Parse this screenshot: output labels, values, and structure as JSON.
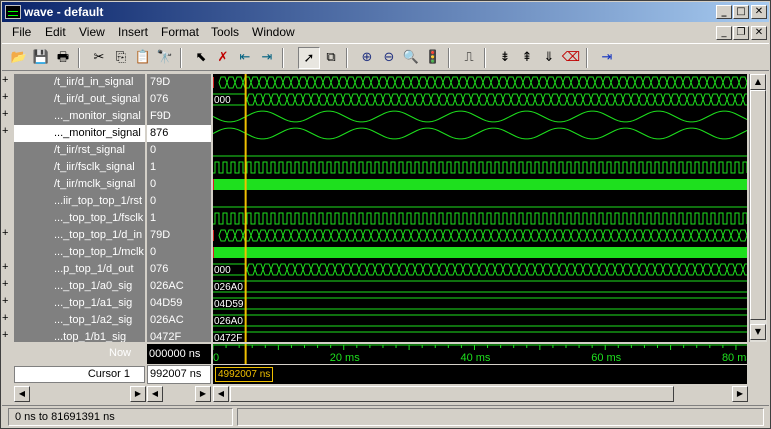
{
  "window": {
    "title": "wave - default"
  },
  "menu": [
    "File",
    "Edit",
    "View",
    "Insert",
    "Format",
    "Tools",
    "Window"
  ],
  "mdi_buttons": {
    "minimize": "_",
    "restore": "❐",
    "close": "✕"
  },
  "toolbar_icons": [
    "open-folder-icon",
    "save-icon",
    "print-icon",
    "cut-icon",
    "copy-icon",
    "paste-icon",
    "find-icon",
    "select-icon",
    "delete-icon",
    "insert-left-icon",
    "insert-right-icon",
    "pointer-icon",
    "zoom-area-icon",
    "zoom-in-icon",
    "zoom-out-icon",
    "zoom-full-icon",
    "traffic-light-icon",
    "find-edge-icon",
    "next-edge-icon",
    "prev-edge-icon",
    "find-value-icon",
    "delete-marker-icon",
    "goto-cursor-icon"
  ],
  "signals": [
    {
      "name": "/t_iir/d_in_signal",
      "value": "79D",
      "expand": true,
      "kind": "bus-dense"
    },
    {
      "name": "/t_iir/d_out_signal",
      "value": "076",
      "expand": true,
      "kind": "bus-dense-early"
    },
    {
      "name": "..._monitor_signal",
      "value": "F9D",
      "expand": true,
      "kind": "analog-fast"
    },
    {
      "name": "..._monitor_signal",
      "value": "876",
      "expand": true,
      "kind": "analog-slow",
      "selected": true
    },
    {
      "name": "/t_iir/rst_signal",
      "value": "0",
      "expand": false,
      "kind": "low"
    },
    {
      "name": "/t_iir/fsclk_signal",
      "value": "1",
      "expand": false,
      "kind": "clock"
    },
    {
      "name": "/t_iir/mclk_signal",
      "value": "0",
      "expand": false,
      "kind": "solid"
    },
    {
      "name": "...iir_top_top_1/rst",
      "value": "0",
      "expand": false,
      "kind": "low"
    },
    {
      "name": "..._top_top_1/fsclk",
      "value": "1",
      "expand": false,
      "kind": "clock"
    },
    {
      "name": "..._top_top_1/d_in",
      "value": "79D",
      "expand": true,
      "kind": "bus-dense"
    },
    {
      "name": "..._top_top_1/mclk",
      "value": "0",
      "expand": false,
      "kind": "solid"
    },
    {
      "name": "...p_top_1/d_out",
      "value": "076",
      "expand": true,
      "kind": "bus-dense-early"
    },
    {
      "name": "..._top_1/a0_sig",
      "value": "026AC",
      "expand": true,
      "kind": "bus-const",
      "label": "026A0"
    },
    {
      "name": "..._top_1/a1_sig",
      "value": "04D59",
      "expand": true,
      "kind": "bus-const",
      "label": "04D59"
    },
    {
      "name": "..._top_1/a2_sig",
      "value": "026AC",
      "expand": true,
      "kind": "bus-const",
      "label": "026A0"
    },
    {
      "name": "...top_1/b1_sig",
      "value": "0472F",
      "expand": true,
      "kind": "bus-const",
      "label": "0472F"
    }
  ],
  "bus_early_label": "000",
  "now": {
    "label": "Now",
    "value": "000000 ns"
  },
  "axis_ticks": [
    {
      "label": "0",
      "pos": 0
    },
    {
      "label": "20 ms",
      "pos": 20
    },
    {
      "label": "40 ms",
      "pos": 40
    },
    {
      "label": "60 ms",
      "pos": 60
    },
    {
      "label": "80 ms",
      "pos": 80
    }
  ],
  "axis_range_ms": [
    0,
    81.69
  ],
  "cursor": {
    "label": "Cursor 1",
    "value": "992007 ns",
    "tag": "4992007 ns",
    "time_ms": 4.992
  },
  "status": {
    "range": "0 ns to 81691391 ns"
  },
  "colors": {
    "wave": "#1ee01e",
    "cursor": "#f0c000",
    "bus_start": "#d02020",
    "title_start": "#0a246a"
  }
}
